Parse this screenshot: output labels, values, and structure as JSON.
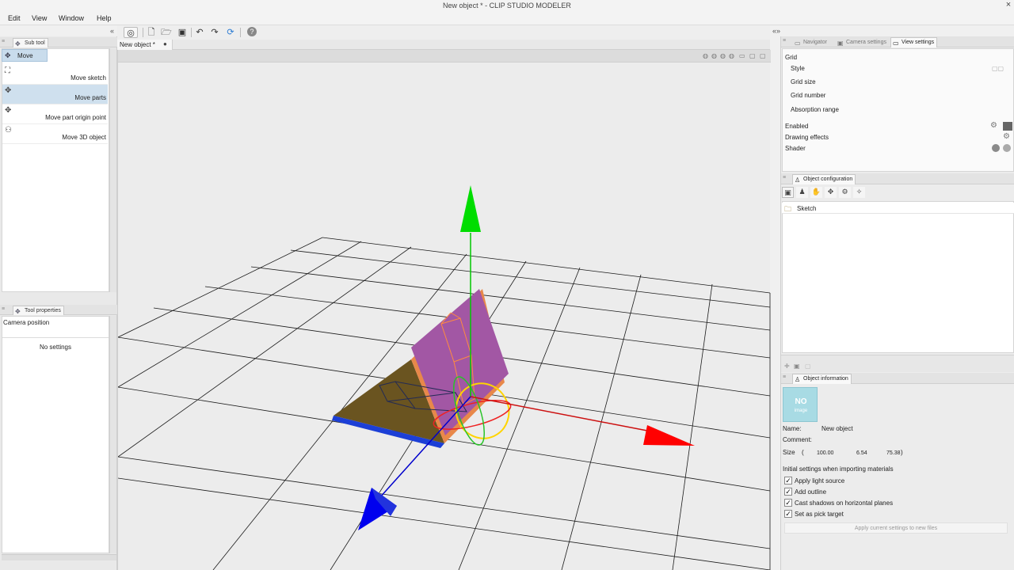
{
  "window": {
    "title": "New object * - CLIP STUDIO MODELER",
    "close": "×"
  },
  "menu": [
    "Edit",
    "View",
    "Window",
    "Help"
  ],
  "left": {
    "subtool": {
      "tab": "Sub tool",
      "active": "Move",
      "items": [
        {
          "label": "Move sketch",
          "icon": "move-sketch-icon",
          "glyph": "⛶"
        },
        {
          "label": "Move parts",
          "icon": "move-parts-icon",
          "glyph": "✥",
          "selected": true
        },
        {
          "label": "Move part origin point",
          "icon": "move-origin-icon",
          "glyph": "✥"
        },
        {
          "label": "Move 3D object",
          "icon": "move-3d-object-icon",
          "glyph": "⚇"
        }
      ]
    },
    "toolprop": {
      "tab": "Tool properties",
      "camera": "Camera position",
      "nosettings": "No settings"
    }
  },
  "document": {
    "tab": "New object *",
    "dot": "●"
  },
  "right": {
    "tabs": [
      "Navigator",
      "Camera settings",
      "View settings"
    ],
    "view": {
      "grid": "Grid",
      "style": "Style",
      "size": "Grid size",
      "number": "Grid number",
      "absorption": "Absorption range",
      "enabled": "Enabled",
      "drawing": "Drawing effects",
      "shader": "Shader"
    },
    "objconf": {
      "tab": "Object configuration",
      "sketch": "Sketch"
    },
    "objinfo": {
      "tab": "Object information",
      "noimage": "NO",
      "noimage_sub": "image",
      "name_label": "Name:",
      "name_value": "New object",
      "comment_label": "Comment:",
      "size_label": "Size",
      "size_open": "(",
      "size_x": "100.00",
      "size_y": "6.54",
      "size_z": "75.38",
      "size_close": ")",
      "initial": "Initial settings when importing materials",
      "checks": [
        "Apply light source",
        "Add outline",
        "Cast shadows on horizontal planes",
        "Set as pick target"
      ],
      "apply": "Apply current settings to new files"
    }
  },
  "colors": {
    "axis_x": "#ff0000",
    "axis_y": "#00dd00",
    "axis_z": "#0000ee",
    "plane_purple": "#a257a4",
    "plane_olive": "#6a5420",
    "plane_orange": "#e8884a",
    "selection_blue": "#c9dcec"
  }
}
